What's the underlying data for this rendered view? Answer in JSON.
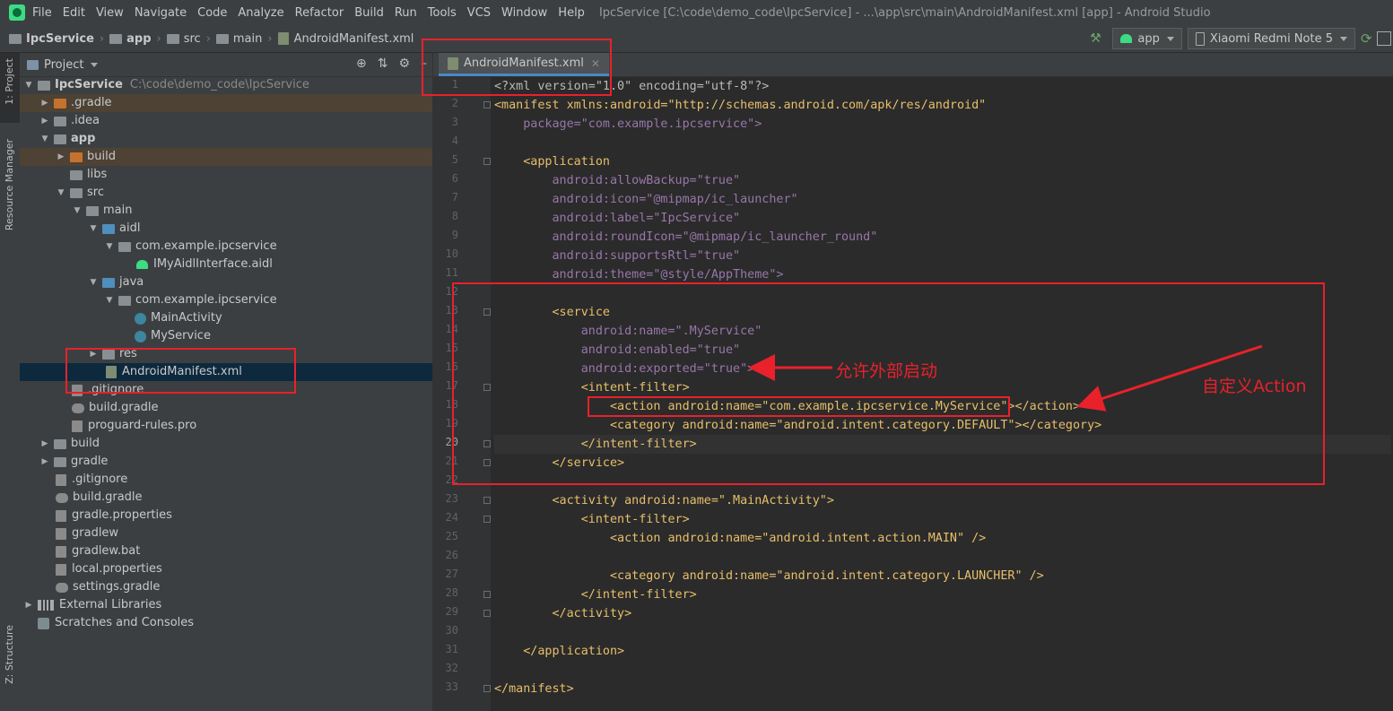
{
  "menubar": {
    "items": [
      "File",
      "Edit",
      "View",
      "Navigate",
      "Code",
      "Analyze",
      "Refactor",
      "Build",
      "Run",
      "Tools",
      "VCS",
      "Window",
      "Help"
    ],
    "title": "IpcService [C:\\code\\demo_code\\IpcService] - ...\\app\\src\\main\\AndroidManifest.xml [app] - Android Studio"
  },
  "breadcrumb": {
    "items": [
      "IpcService",
      "app",
      "src",
      "main",
      "AndroidManifest.xml"
    ]
  },
  "toolbar": {
    "run_config": "app",
    "device": "Xiaomi Redmi Note 5"
  },
  "sidestrip": {
    "project": "1: Project",
    "resource_manager": "Resource Manager",
    "structure": "Z: Structure"
  },
  "project_panel": {
    "header": "Project",
    "root_name": "IpcService",
    "root_path": "C:\\code\\demo_code\\IpcService",
    "items": [
      {
        "label": ".gradle"
      },
      {
        "label": ".idea"
      },
      {
        "label": "app"
      },
      {
        "label": "build"
      },
      {
        "label": "libs"
      },
      {
        "label": "src"
      },
      {
        "label": "main"
      },
      {
        "label": "aidl"
      },
      {
        "label": "com.example.ipcservice"
      },
      {
        "label": "IMyAidlInterface.aidl"
      },
      {
        "label": "java"
      },
      {
        "label": "com.example.ipcservice"
      },
      {
        "label": "MainActivity"
      },
      {
        "label": "MyService"
      },
      {
        "label": "res"
      },
      {
        "label": "AndroidManifest.xml"
      },
      {
        "label": ".gitignore"
      },
      {
        "label": "build.gradle"
      },
      {
        "label": "proguard-rules.pro"
      },
      {
        "label": "build"
      },
      {
        "label": "gradle"
      },
      {
        "label": ".gitignore"
      },
      {
        "label": "build.gradle"
      },
      {
        "label": "gradle.properties"
      },
      {
        "label": "gradlew"
      },
      {
        "label": "gradlew.bat"
      },
      {
        "label": "local.properties"
      },
      {
        "label": "settings.gradle"
      },
      {
        "label": "External Libraries"
      },
      {
        "label": "Scratches and Consoles"
      }
    ]
  },
  "editor": {
    "tab_label": "AndroidManifest.xml",
    "current_line": 20,
    "line_numbers": [
      "1",
      "2",
      "3",
      "4",
      "5",
      "6",
      "7",
      "8",
      "9",
      "10",
      "11",
      "12",
      "13",
      "14",
      "15",
      "16",
      "17",
      "18",
      "19",
      "20",
      "21",
      "22",
      "23",
      "24",
      "25",
      "26",
      "27",
      "28",
      "29",
      "30",
      "31",
      "32",
      "33"
    ],
    "lines": [
      "<?xml version=\"1.0\" encoding=\"utf-8\"?>",
      "<manifest xmlns:android=\"http://schemas.android.com/apk/res/android\"",
      "    package=\"com.example.ipcservice\">",
      "",
      "    <application",
      "        android:allowBackup=\"true\"",
      "        android:icon=\"@mipmap/ic_launcher\"",
      "        android:label=\"IpcService\"",
      "        android:roundIcon=\"@mipmap/ic_launcher_round\"",
      "        android:supportsRtl=\"true\"",
      "        android:theme=\"@style/AppTheme\">",
      "",
      "        <service",
      "            android:name=\".MyService\"",
      "            android:enabled=\"true\"",
      "            android:exported=\"true\">",
      "            <intent-filter>",
      "                <action android:name=\"com.example.ipcservice.MyService\"></action>",
      "                <category android:name=\"android.intent.category.DEFAULT\"></category>",
      "            </intent-filter>",
      "        </service>",
      "",
      "        <activity android:name=\".MainActivity\">",
      "            <intent-filter>",
      "                <action android:name=\"android.intent.action.MAIN\" />",
      "",
      "                <category android:name=\"android.intent.category.LAUNCHER\" />",
      "            </intent-filter>",
      "        </activity>",
      "",
      "    </application>",
      "",
      "</manifest>"
    ]
  },
  "annotations": {
    "exported_note": "允许外部启动",
    "action_note": "自定义Action",
    "color": "#e8212b"
  }
}
